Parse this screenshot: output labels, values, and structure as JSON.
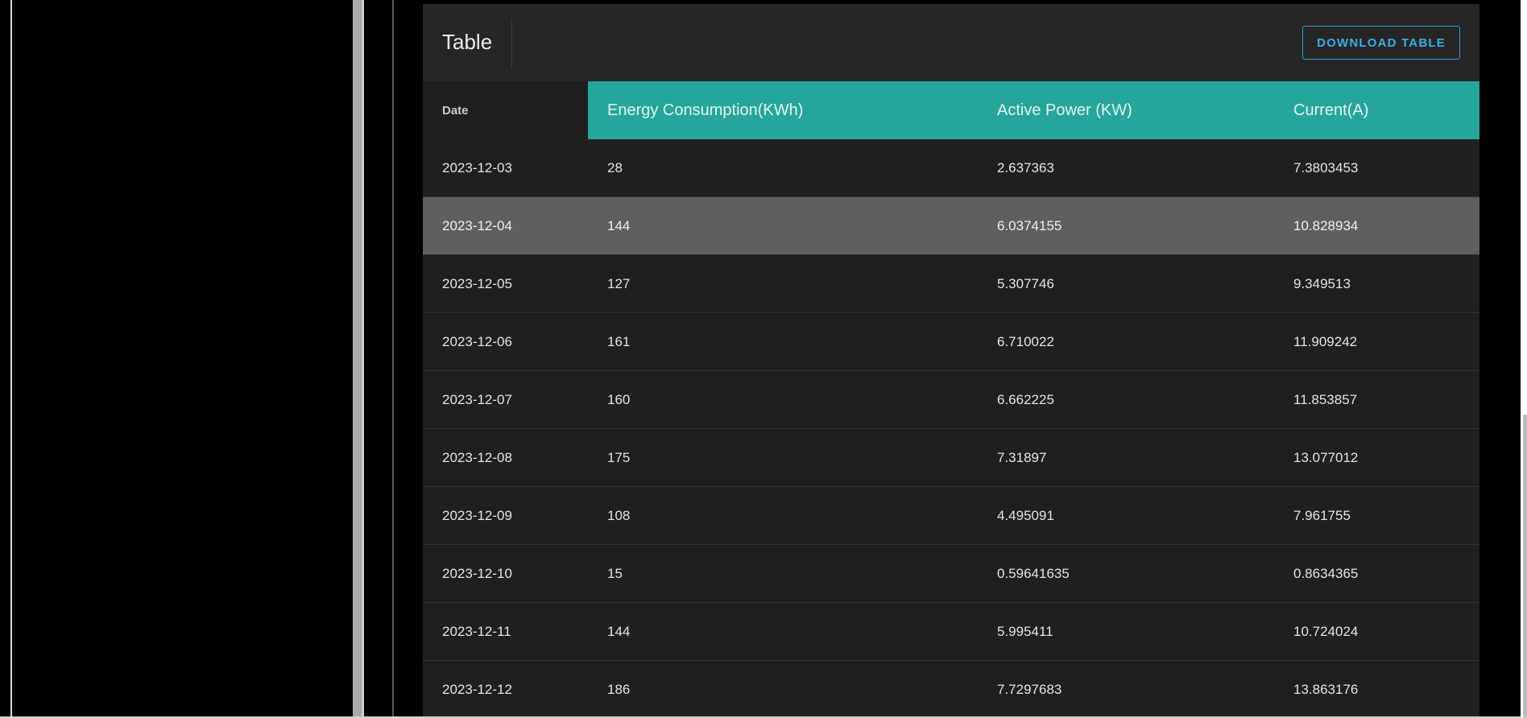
{
  "panel": {
    "title": "Table",
    "download_label": "DOWNLOAD TABLE"
  },
  "table": {
    "headers": [
      "Date",
      "Energy Consumption(KWh)",
      "Active Power (KW)",
      "Current(A)"
    ],
    "rows": [
      [
        "2023-12-03",
        "28",
        "2.637363",
        "7.3803453"
      ],
      [
        "2023-12-04",
        "144",
        "6.0374155",
        "10.828934"
      ],
      [
        "2023-12-05",
        "127",
        "5.307746",
        "9.349513"
      ],
      [
        "2023-12-06",
        "161",
        "6.710022",
        "11.909242"
      ],
      [
        "2023-12-07",
        "160",
        "6.662225",
        "11.853857"
      ],
      [
        "2023-12-08",
        "175",
        "7.31897",
        "13.077012"
      ],
      [
        "2023-12-09",
        "108",
        "4.495091",
        "7.961755"
      ],
      [
        "2023-12-10",
        "15",
        "0.59641635",
        "0.8634365"
      ],
      [
        "2023-12-11",
        "144",
        "5.995411",
        "10.724024"
      ],
      [
        "2023-12-12",
        "186",
        "7.7297683",
        "13.863176"
      ]
    ],
    "highlighted_row_index": 1
  },
  "colors": {
    "header_accent": "#26a69a",
    "button_accent": "#2aa3d6",
    "highlight_row": "#5f5f5f"
  }
}
